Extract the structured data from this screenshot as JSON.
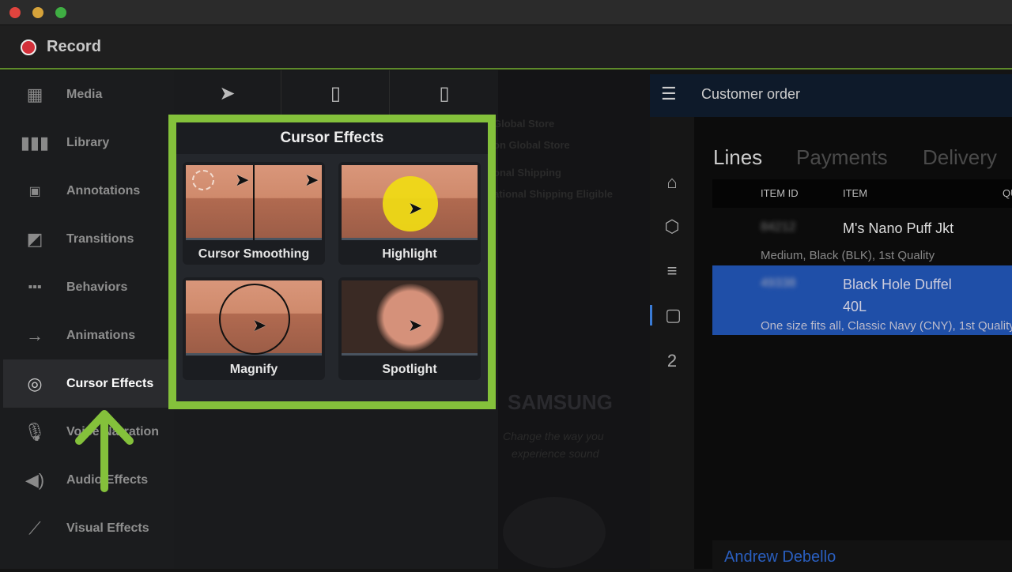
{
  "window": {
    "record_label": "Record"
  },
  "sidebar": {
    "items": [
      {
        "label": "Media",
        "icon": "film-icon"
      },
      {
        "label": "Library",
        "icon": "books-icon"
      },
      {
        "label": "Annotations",
        "icon": "annotation-icon"
      },
      {
        "label": "Transitions",
        "icon": "transition-icon"
      },
      {
        "label": "Behaviors",
        "icon": "behaviors-icon"
      },
      {
        "label": "Animations",
        "icon": "animation-arrow-icon"
      },
      {
        "label": "Cursor Effects",
        "icon": "cursor-effects-icon",
        "selected": true
      },
      {
        "label": "Voice Narration",
        "icon": "microphone-icon"
      },
      {
        "label": "Audio Effects",
        "icon": "speaker-icon"
      },
      {
        "label": "Visual Effects",
        "icon": "magic-wand-icon"
      }
    ]
  },
  "popup": {
    "title": "Cursor Effects",
    "cards": [
      {
        "label": "Cursor Smoothing"
      },
      {
        "label": "Highlight"
      },
      {
        "label": "Magnify"
      },
      {
        "label": "Spotlight"
      }
    ]
  },
  "web": {
    "lines": [
      "Global Store",
      "on Global Store",
      "onal Shipping",
      "ational Shipping Eligible"
    ],
    "ad_brand": "SAMSUNG",
    "ad_line1": "Change the way you",
    "ad_line2": "experience sound"
  },
  "app": {
    "title": "Customer order",
    "tabs": [
      "Lines",
      "Payments",
      "Delivery"
    ],
    "columns": [
      "ITEM ID",
      "ITEM",
      "QU"
    ],
    "nav_count": "2",
    "rows": [
      {
        "id": "84212",
        "item": "M's Nano Puff Jkt",
        "item2": "",
        "desc": "Medium, Black (BLK), 1st Quality",
        "selected": false
      },
      {
        "id": "49338",
        "item": "Black Hole Duffel",
        "item2": "40L",
        "desc": "One size fits all, Classic Navy (CNY), 1st Quality",
        "selected": true
      }
    ],
    "customer": "Andrew Debello",
    "selection_color": "#1f4fa8"
  },
  "accent": "#84c13b"
}
